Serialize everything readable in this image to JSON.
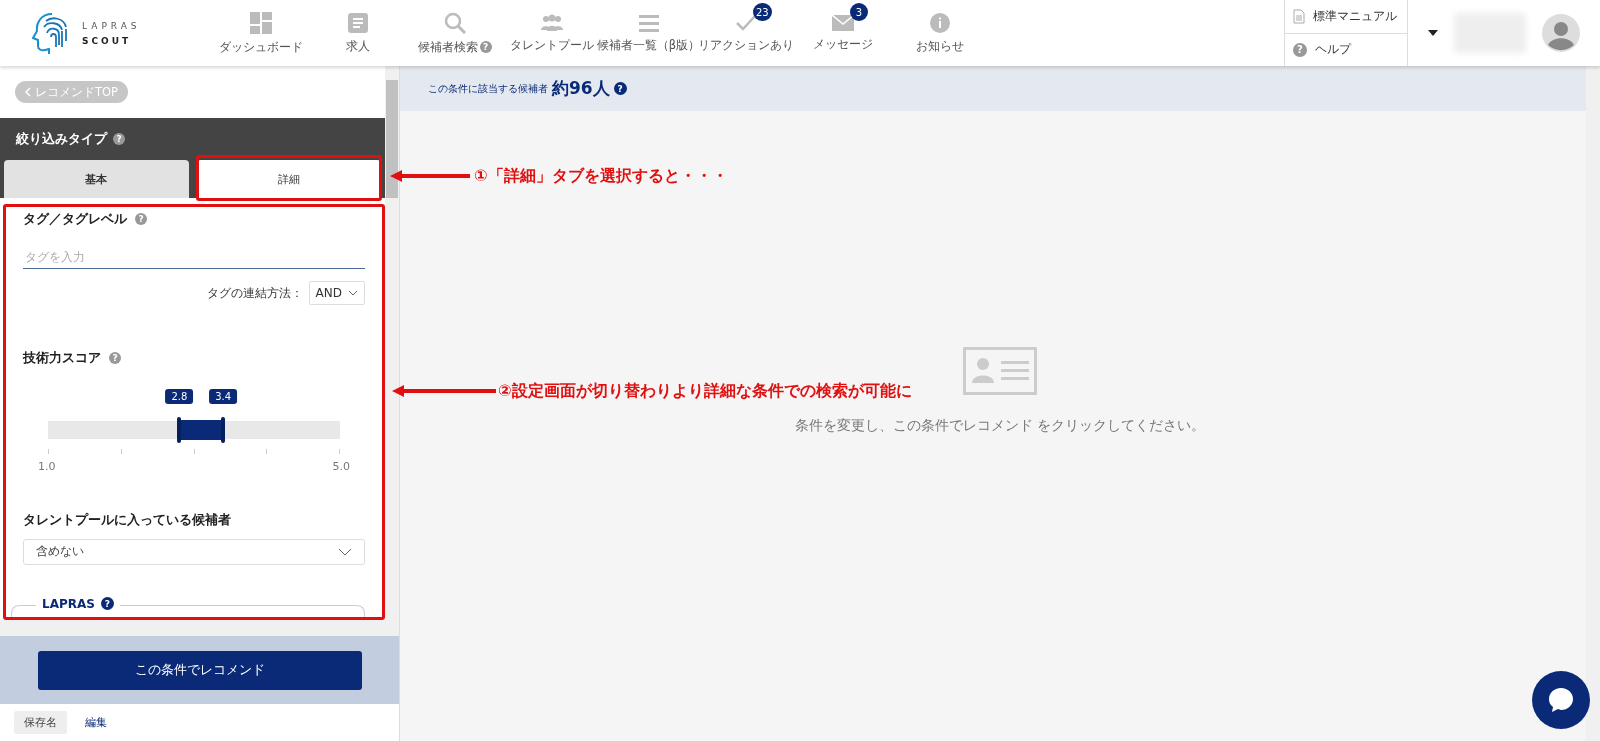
{
  "logo": {
    "line_1": "LAPRAS",
    "line_2": "SCOUT"
  },
  "nav": [
    {
      "label": "ダッシュボード",
      "kind": "dashboard"
    },
    {
      "label": "求人",
      "kind": "document"
    },
    {
      "label": "候補者検索",
      "kind": "search",
      "help": "?"
    },
    {
      "label": "タレントプール",
      "kind": "people"
    },
    {
      "label": "候補者一覧（β版）",
      "kind": "list"
    },
    {
      "label": "リアクションあり",
      "kind": "check",
      "badge": "23"
    },
    {
      "label": "メッセージ",
      "kind": "mail",
      "badge": "3"
    },
    {
      "label": "お知らせ",
      "kind": "info"
    }
  ],
  "header_links": [
    {
      "label": "標準マニュアル",
      "kind": "file"
    },
    {
      "label": "ヘルプ",
      "kind": "help",
      "help": "?"
    }
  ],
  "sidebar": {
    "back_button": "レコメンドTOP",
    "filter_title": "絞り込みタイプ",
    "filter_help": "?",
    "tabs": [
      {
        "label": "基本",
        "selected": false
      },
      {
        "label": "詳細",
        "selected": true
      }
    ],
    "tag_section": {
      "title": "タグ／タグレベル",
      "help": "?",
      "placeholder": "タグを入力",
      "join_label": "タグの連結方法：",
      "join_value": "AND"
    },
    "score": {
      "title": "技術力スコア",
      "help": "?",
      "handles": [
        {
          "label": "2.8",
          "level": 0.45
        },
        {
          "label": "3.4",
          "level": 0.6
        }
      ],
      "min_label": "1.0",
      "max_label": "5.0"
    },
    "pool": {
      "title": "タレントプールに入っている候補者",
      "value": "含めない"
    },
    "lapras_legend": "LAPRAS",
    "lapras_help": "?",
    "recommend_button": "この条件でレコメンド",
    "save_name": "保存名",
    "edit_link": "編集"
  },
  "main": {
    "count_prefix": "この条件に該当する候補者",
    "count_value": "約96人",
    "count_help": "?",
    "message": "条件を変更し、この条件でレコメンド をクリックしてください。"
  },
  "annotations": [
    {
      "text": "①「詳細」タブを選択すると・・・"
    },
    {
      "text": "②設定画面が切り替わりより詳細な条件での検索が可能に"
    }
  ]
}
